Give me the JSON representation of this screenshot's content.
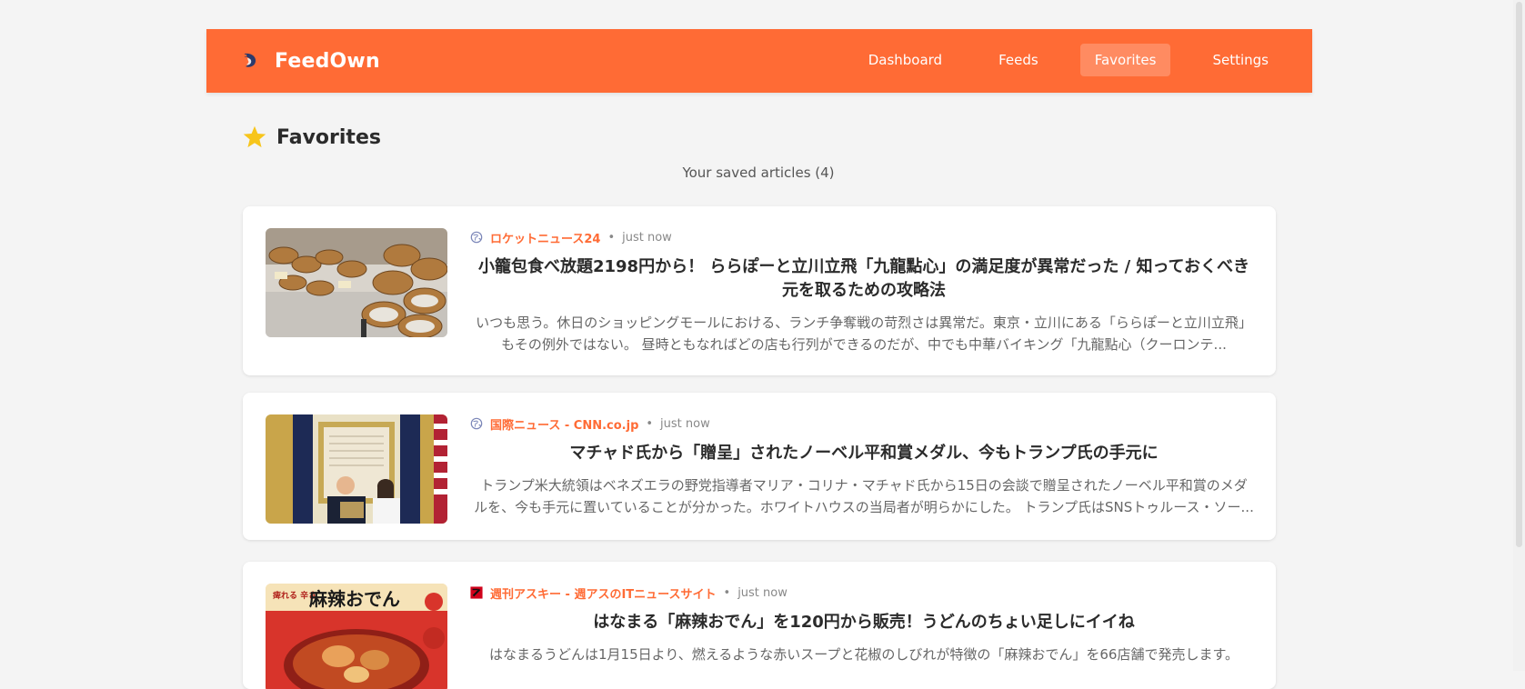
{
  "app": {
    "brand": "FeedOwn",
    "nav": [
      {
        "label": "Dashboard",
        "active": false
      },
      {
        "label": "Feeds",
        "active": false
      },
      {
        "label": "Favorites",
        "active": true
      },
      {
        "label": "Settings",
        "active": false
      }
    ],
    "accent_color": "#ff6b35"
  },
  "page": {
    "icon": "star-icon",
    "title": "Favorites",
    "subtitle": "Your saved articles (4)"
  },
  "articles": [
    {
      "favicon": "globe-icon",
      "source": "ロケットニュース24",
      "separator": "•",
      "time": "just now",
      "title": "小籠包食べ放題2198円から！ ららぽーと立川立飛「九龍點心」の満足度が異常だった / 知っておくべき元を取るための攻略法",
      "excerpt": "いつも思う。休日のショッピングモールにおける、ランチ争奪戦の苛烈さは異常だ。東京・立川にある「ららぽーと立川立飛」もその例外ではない。 昼時ともなればどの店も行列ができるのだが、中でも中華バイキング「九龍點心（クーロンテ...",
      "image": "dim-sum-steamers-photo"
    },
    {
      "favicon": "globe-icon",
      "source": "国際ニュース - CNN.co.jp",
      "separator": "•",
      "time": "just now",
      "title": "マチャド氏から「贈呈」されたノーベル平和賞メダル、今もトランプ氏の手元に",
      "excerpt": "トランプ米大統領はベネズエラの野党指導者マリア・コリナ・マチャド氏から15日の会談で贈呈されたノーベル平和賞のメダルを、今も手元に置いていることが分かった。ホワイトハウスの当局者が明らかにした。 トランプ氏はSNSトゥルース・ソー...",
      "image": "oval-office-photo"
    },
    {
      "favicon": "ascii-icon",
      "source": "週刊アスキー - 週アスのITニュースサイト",
      "separator": "•",
      "time": "just now",
      "title": "はなまる「麻辣おでん」を120円から販売！うどんのちょい足しにイイね",
      "excerpt": "はなまるうどんは1月15日より、燃えるような赤いスープと花椒のしびれが特徴の「麻辣おでん」を66店舗で発売します。",
      "image": "mala-oden-photo",
      "image_text": "痺れる 辛さ 麻辣おでん"
    }
  ]
}
